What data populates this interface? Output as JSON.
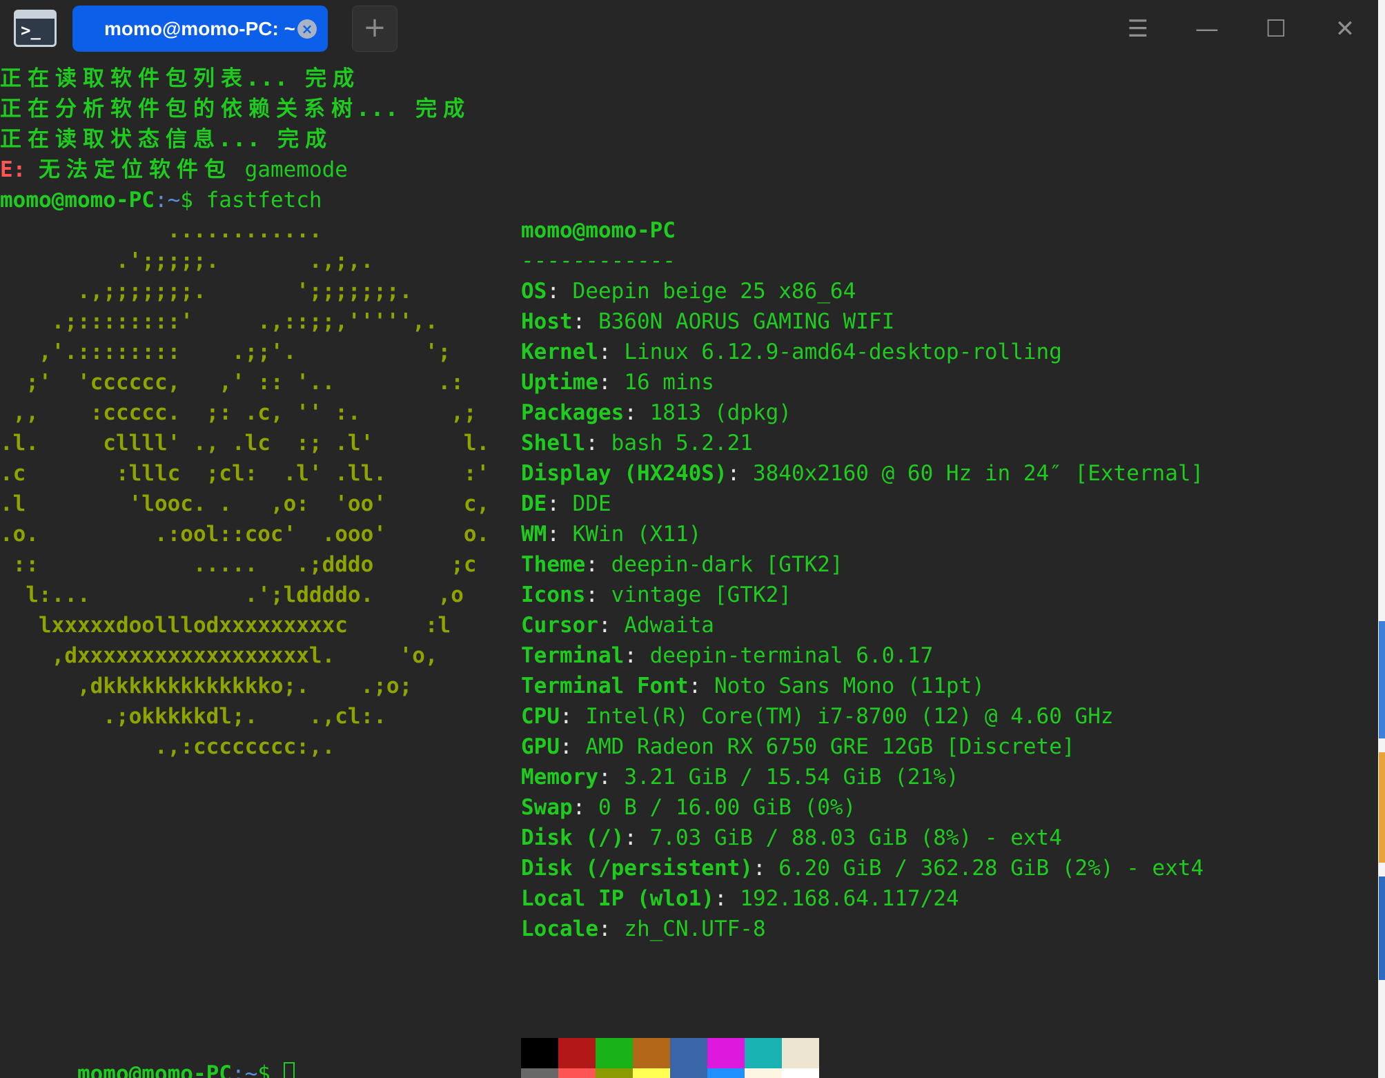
{
  "tab": {
    "title": "momo@momo-PC: ~",
    "close_symbol": "×",
    "add_symbol": "+"
  },
  "window_controls": {
    "menu": "☰",
    "minimize": "—",
    "maximize": "☐",
    "close": "✕"
  },
  "output": [
    {
      "parts": [
        {
          "t": "正在读取软件包列表... 完成",
          "c": "cjk"
        }
      ]
    },
    {
      "parts": [
        {
          "t": "正在分析软件包的依赖关系树... 完成",
          "c": "cjk"
        }
      ]
    },
    {
      "parts": [
        {
          "t": "正在读取状态信息... 完成",
          "c": "cjk"
        }
      ]
    },
    {
      "parts": [
        {
          "t": "E: ",
          "c": "red"
        },
        {
          "t": "无法定位软件包",
          "c": "cjk"
        },
        {
          "t": " gamemode",
          "c": "green"
        }
      ]
    },
    {
      "parts": [
        {
          "t": "momo@momo-PC",
          "c": "bgreen"
        },
        {
          "t": ":~",
          "c": "blue"
        },
        {
          "t": "$ fastfetch",
          "c": "green"
        }
      ]
    }
  ],
  "logo_lines": [
    "             ............",
    "         .';;;;;.       .,;,.",
    "      .,;;;;;;;.       ';;;;;;;.",
    "    .;::::::::'     .,::;;,''''',.",
    "   ,'.::::::::    .;;'.          ';",
    "  ;'  'cccccc,   ,' :: '..        .:",
    " ,,    :ccccc.  ;: .c, '' :.       ,;",
    ".l.     cllll' ., .lc  :; .l'       l.",
    ".c       :lllc  ;cl:  .l' .ll.      :'",
    ".l        'looc. .   ,o:  'oo'      c,",
    ".o.         .:ool::coc'  .ooo'      o.",
    " ::            .....   .;dddo      ;c",
    "  l:...            .';lddddo.     ,o",
    "   lxxxxxdoolllodxxxxxxxxxc      :l",
    "    ,dxxxxxxxxxxxxxxxxxxl.     'o,",
    "      ,dkkkkkkkkkkkkko;.    .;o;",
    "        .;okkkkkdl;.    .,cl:.",
    "            .,:cccccccc:,."
  ],
  "info": {
    "user_host": "momo@momo-PC",
    "separator": "------------",
    "rows": [
      {
        "key": "OS",
        "value": "Deepin beige 25 x86_64"
      },
      {
        "key": "Host",
        "value": "B360N AORUS GAMING WIFI"
      },
      {
        "key": "Kernel",
        "value": "Linux 6.12.9-amd64-desktop-rolling"
      },
      {
        "key": "Uptime",
        "value": "16 mins"
      },
      {
        "key": "Packages",
        "value": "1813 (dpkg)"
      },
      {
        "key": "Shell",
        "value": "bash 5.2.21"
      },
      {
        "key": "Display (HX240S)",
        "value": "3840x2160 @ 60 Hz in 24″ [External]"
      },
      {
        "key": "DE",
        "value": "DDE"
      },
      {
        "key": "WM",
        "value": "KWin (X11)"
      },
      {
        "key": "Theme",
        "value": "deepin-dark [GTK2]"
      },
      {
        "key": "Icons",
        "value": "vintage [GTK2]"
      },
      {
        "key": "Cursor",
        "value": "Adwaita"
      },
      {
        "key": "Terminal",
        "value": "deepin-terminal 6.0.17"
      },
      {
        "key": "Terminal Font",
        "value": "Noto Sans Mono (11pt)"
      },
      {
        "key": "CPU",
        "value": "Intel(R) Core(TM) i7-8700 (12) @ 4.60 GHz"
      },
      {
        "key": "GPU",
        "value": "AMD Radeon RX 6750 GRE 12GB [Discrete]"
      },
      {
        "key": "Memory",
        "value": "3.21 GiB / 15.54 GiB (21%)"
      },
      {
        "key": "Swap",
        "value": "0 B / 16.00 GiB (0%)"
      },
      {
        "key": "Disk (/)",
        "value": "7.03 GiB / 88.03 GiB (8%) - ext4"
      },
      {
        "key": "Disk (/persistent)",
        "value": "6.20 GiB / 362.28 GiB (2%) - ext4"
      },
      {
        "key": "Local IP (wlo1)",
        "value": "192.168.64.117/24"
      },
      {
        "key": "Locale",
        "value": "zh_CN.UTF-8"
      }
    ]
  },
  "palette": {
    "normal": [
      "#000000",
      "#b21818",
      "#18b218",
      "#b26818",
      "#3a65a8",
      "#dd19dd",
      "#18b2b2",
      "#ede4d2"
    ],
    "bright": [
      "#686868",
      "#ff5454",
      "#8a9a00",
      "#ffff54",
      "#3a65a8",
      "#1e90ff",
      "#fdf6e3",
      "#ffffff"
    ]
  },
  "prompt": {
    "user_host": "momo@momo-PC",
    "path": ":~",
    "symbol": "$ "
  }
}
